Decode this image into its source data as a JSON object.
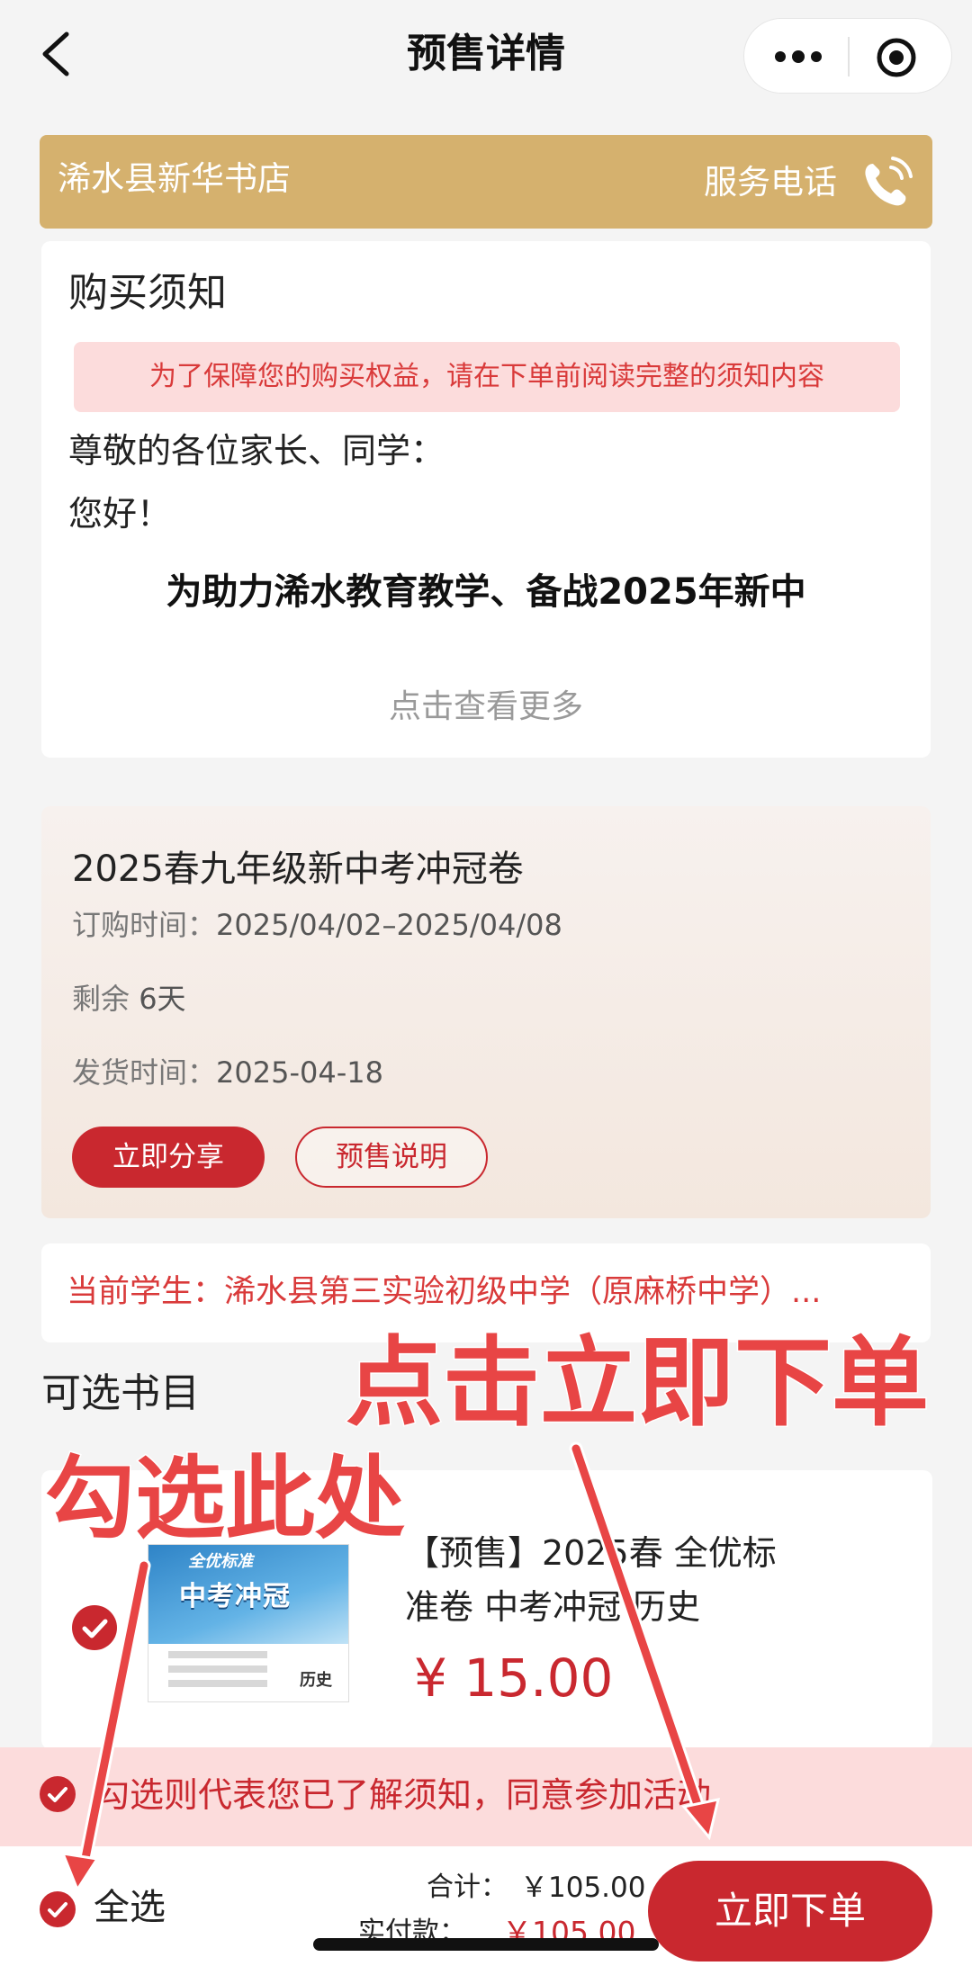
{
  "nav": {
    "title": "预售详情"
  },
  "store": {
    "name": "浠水县新华书店",
    "service_label": "服务电话"
  },
  "notice": {
    "title": "购买须知",
    "banner": "为了保障您的购买权益，请在下单前阅读完整的须知内容",
    "greeting_line1": "尊敬的各位家长、同学：",
    "greeting_line2": "您好！",
    "body": "为助力浠水教育教学、备战2025年新中",
    "see_more": "点击查看更多"
  },
  "presale": {
    "title": "2025春九年级新中考冲冠卷",
    "order_time_label": "订购时间：",
    "order_time_value": "2025/04/02–2025/04/08",
    "remaining_label": "剩余",
    "remaining_value": "6天",
    "ship_time_label": "发货时间：",
    "ship_time_value": "2025-04-18",
    "share_button": "立即分享",
    "explain_button": "预售说明"
  },
  "student": {
    "text": "当前学生：浠水县第三实验初级中学（原麻桥中学）..."
  },
  "books": {
    "heading": "可选书目",
    "items": [
      {
        "name": "【预售】2025春 全优标准卷 中考冲冠 历史",
        "price": "¥ 15.00",
        "checked": true,
        "cover": {
          "series": "全优标准",
          "title": "中考冲冠",
          "subject": "历史"
        }
      }
    ]
  },
  "agree": {
    "text": "勾选则代表您已了解须知，同意参加活动",
    "checked": true
  },
  "footer": {
    "select_all": "全选",
    "total_label": "合计：",
    "total_value": "￥105.00",
    "paid_label": "实付款：",
    "paid_value": "￥105.00",
    "order_button": "立即下单"
  },
  "annotations": {
    "order_hint": "点击立即下单",
    "check_hint": "勾选此处",
    "color": "#e84545"
  },
  "colors": {
    "accent": "#c9282f",
    "store_bar": "#d5b16e",
    "banner_bg": "#fcdcdc"
  }
}
